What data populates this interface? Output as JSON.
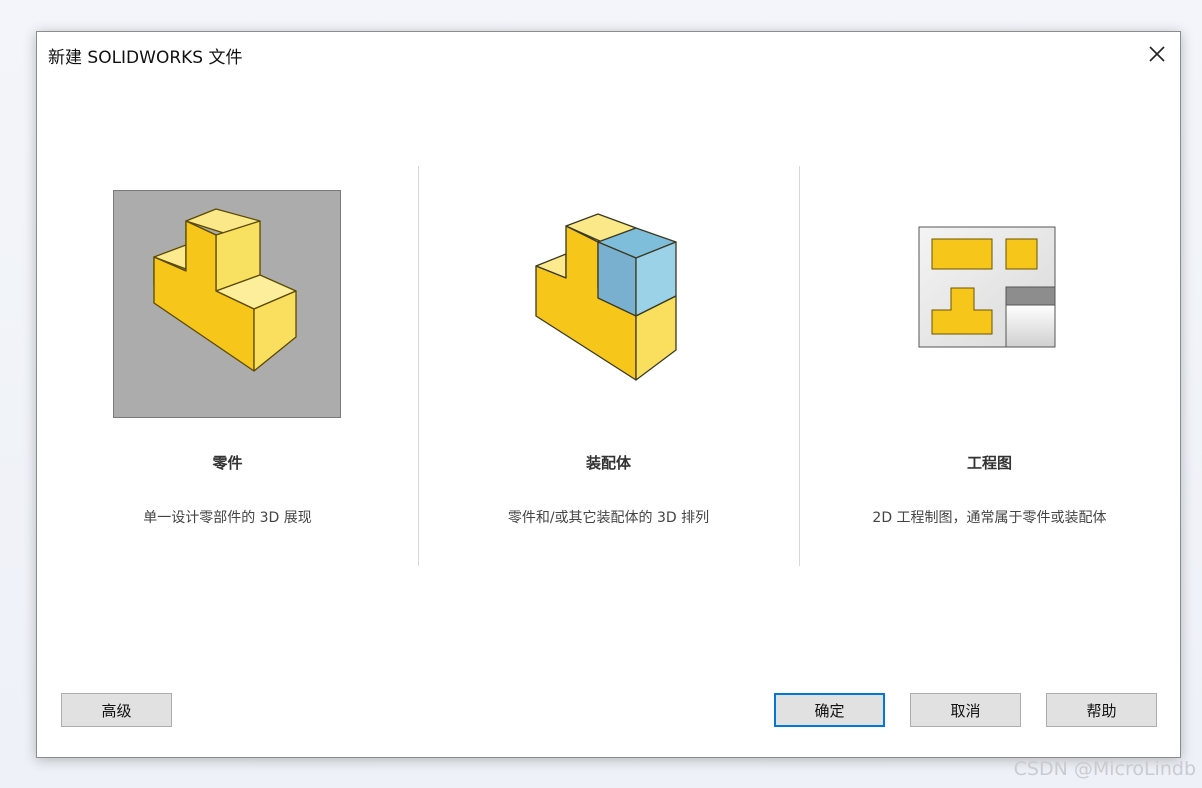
{
  "dialog": {
    "title": "新建 SOLIDWORKS 文件",
    "close_label": "✕"
  },
  "options": [
    {
      "label": "零件",
      "description": "单一设计零部件的 3D 展现",
      "selected": true
    },
    {
      "label": "装配体",
      "description": "零件和/或其它装配体的 3D 排列",
      "selected": false
    },
    {
      "label": "工程图",
      "description": "2D 工程制图，通常属于零件或装配体",
      "selected": false
    }
  ],
  "buttons": {
    "advanced": "高级",
    "ok": "确定",
    "cancel": "取消",
    "help": "帮助"
  },
  "colors": {
    "selection_bg": "#acacac",
    "part_yellow": "#f5c81e",
    "assembly_blue": "#8ec9e4",
    "default_button_border": "#0078d7"
  },
  "watermark": "CSDN @MicroLindb"
}
